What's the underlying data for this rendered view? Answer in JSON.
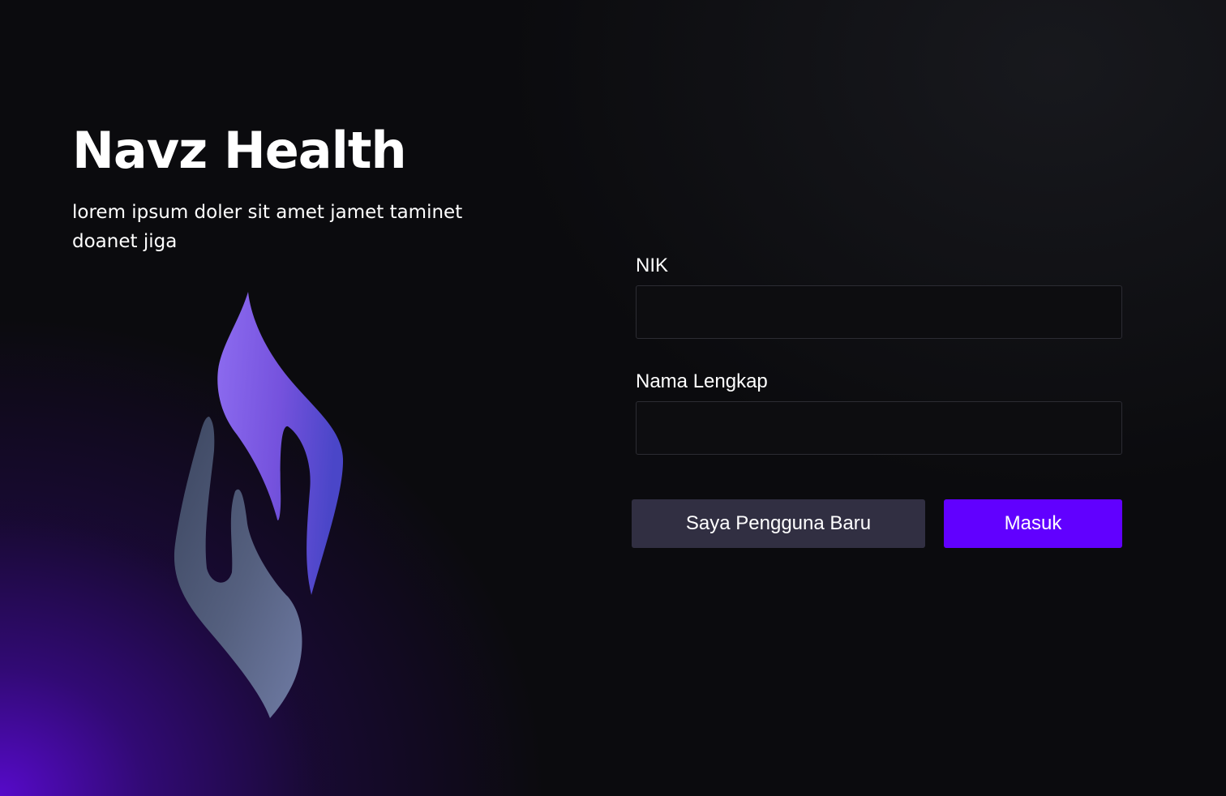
{
  "app": {
    "title": "Navz Health",
    "tagline": "lorem ipsum doler sit amet jamet taminet doanet jiga",
    "logo_icon": "hands-logo-icon"
  },
  "form": {
    "nik": {
      "label": "NIK",
      "value": "",
      "placeholder": ""
    },
    "full_name": {
      "label": "Nama Lengkap",
      "value": "",
      "placeholder": ""
    },
    "new_user_button": "Saya Pengguna Baru",
    "login_button": "Masuk"
  },
  "colors": {
    "background": "#0b0b0e",
    "accent": "#6100ff",
    "secondary_button": "#312f42",
    "input_background": "#0d0d10",
    "glow": "#5a0acd"
  }
}
